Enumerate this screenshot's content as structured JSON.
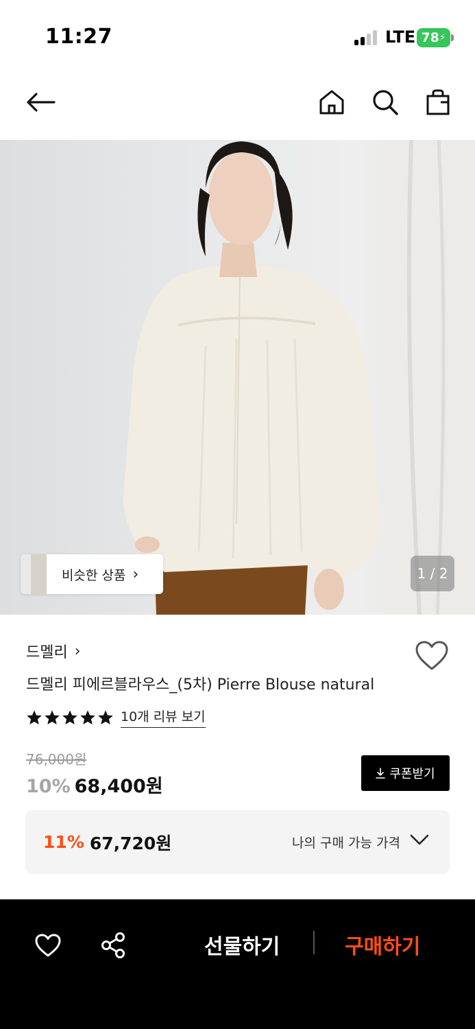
{
  "status_bar": {
    "time": "11:27",
    "network": "LTE",
    "battery": "78"
  },
  "hero": {
    "similar_label": "비슷한 상품",
    "page_counter": "1 / 2"
  },
  "product": {
    "brand": "드멜리",
    "title": "드멜리 피에르블라우스_(5차) Pierre Blouse natural",
    "rating_stars": 5,
    "review_link": "10개 리뷰 보기",
    "original_price": "76,000원",
    "discount_rate": "10%",
    "sale_price": "68,400원",
    "coupon_label": "쿠폰받기"
  },
  "my_price": {
    "rate": "11%",
    "price": "67,720원",
    "label": "나의 구매 가능 가격"
  },
  "bottom_bar": {
    "gift_label": "선물하기",
    "buy_label": "구매하기"
  },
  "colors": {
    "accent": "#ff4e13",
    "battery": "#34c759"
  }
}
